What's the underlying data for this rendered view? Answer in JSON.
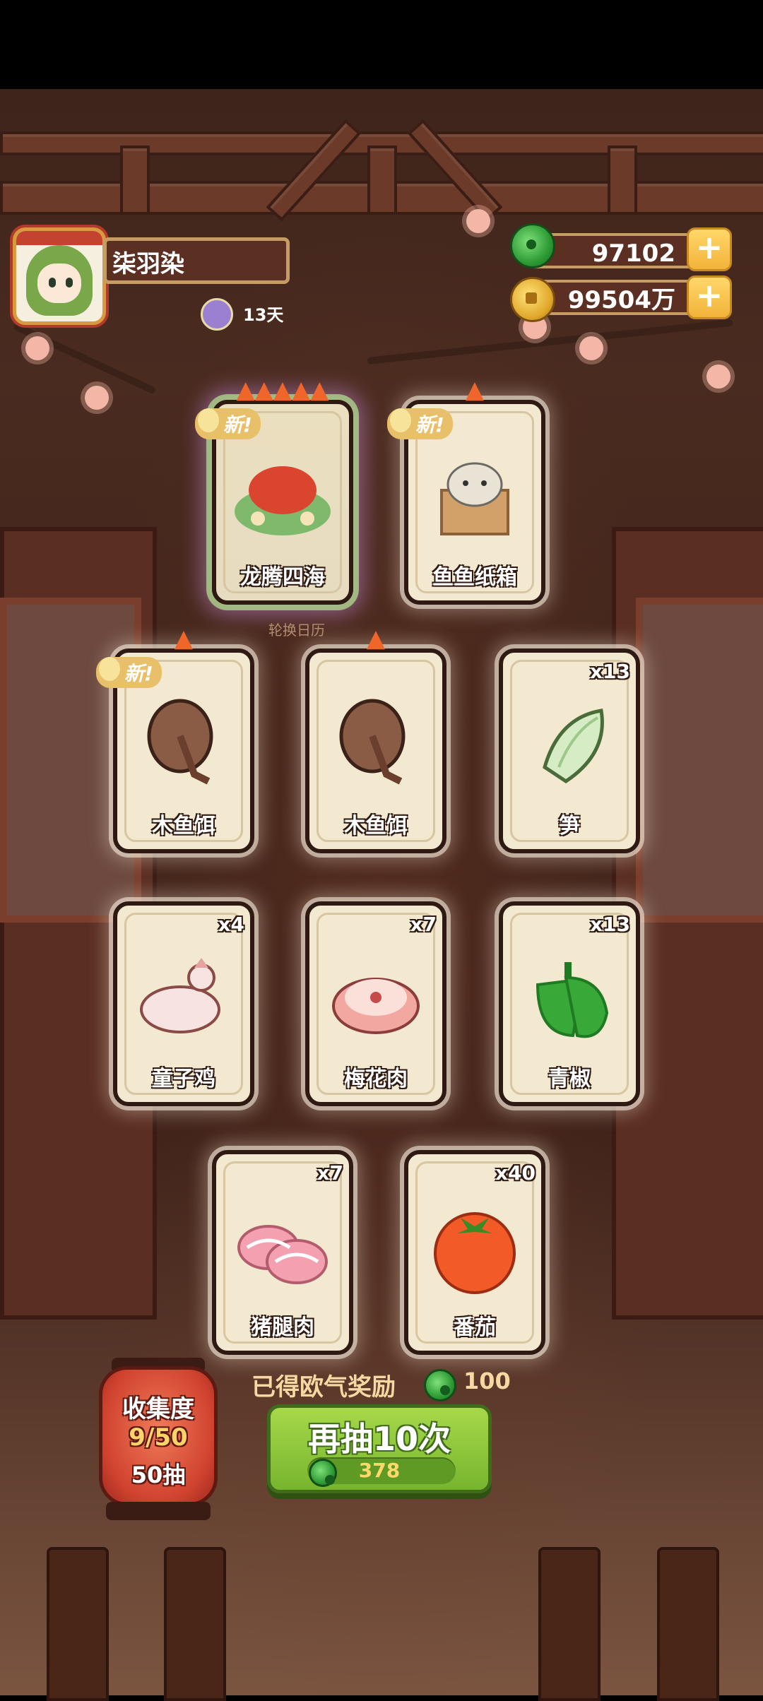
{
  "player": {
    "name": "柒羽染",
    "days": "13天"
  },
  "resources": {
    "jade": "97102",
    "coins": "99504万"
  },
  "cards": [
    {
      "name": "龙腾四海",
      "count": "",
      "new": "新!",
      "flames": 5,
      "rare": true
    },
    {
      "name": "鱼鱼纸箱",
      "count": "",
      "new": "新!",
      "flames": 1,
      "rare": false
    },
    {
      "name": "木鱼饵",
      "count": "",
      "new": "新!",
      "flames": 1,
      "rare": false
    },
    {
      "name": "木鱼饵",
      "count": "",
      "new": "",
      "flames": 1,
      "rare": false
    },
    {
      "name": "笋",
      "count": "x13",
      "new": "",
      "flames": 0,
      "rare": false
    },
    {
      "name": "童子鸡",
      "count": "x4",
      "new": "",
      "flames": 0,
      "rare": false
    },
    {
      "name": "梅花肉",
      "count": "x7",
      "new": "",
      "flames": 0,
      "rare": false
    },
    {
      "name": "青椒",
      "count": "x13",
      "new": "",
      "flames": 0,
      "rare": false
    },
    {
      "name": "猪腿肉",
      "count": "x7",
      "new": "",
      "flames": 0,
      "rare": false
    },
    {
      "name": "番茄",
      "count": "x40",
      "new": "",
      "flames": 0,
      "rare": false
    }
  ],
  "calendar_label": "轮换日历",
  "reward": {
    "label": "已得欧气奖励",
    "value": "100"
  },
  "draw_button": {
    "title": "再抽10次",
    "cost": "378"
  },
  "collection": {
    "title": "收集度",
    "progress": "9/50",
    "draws": "50抽"
  },
  "colors": {
    "primary_button": "#77b52e",
    "lantern": "#d0422f",
    "card_bg": "#f3e8d0",
    "wood": "#5b2f22"
  }
}
